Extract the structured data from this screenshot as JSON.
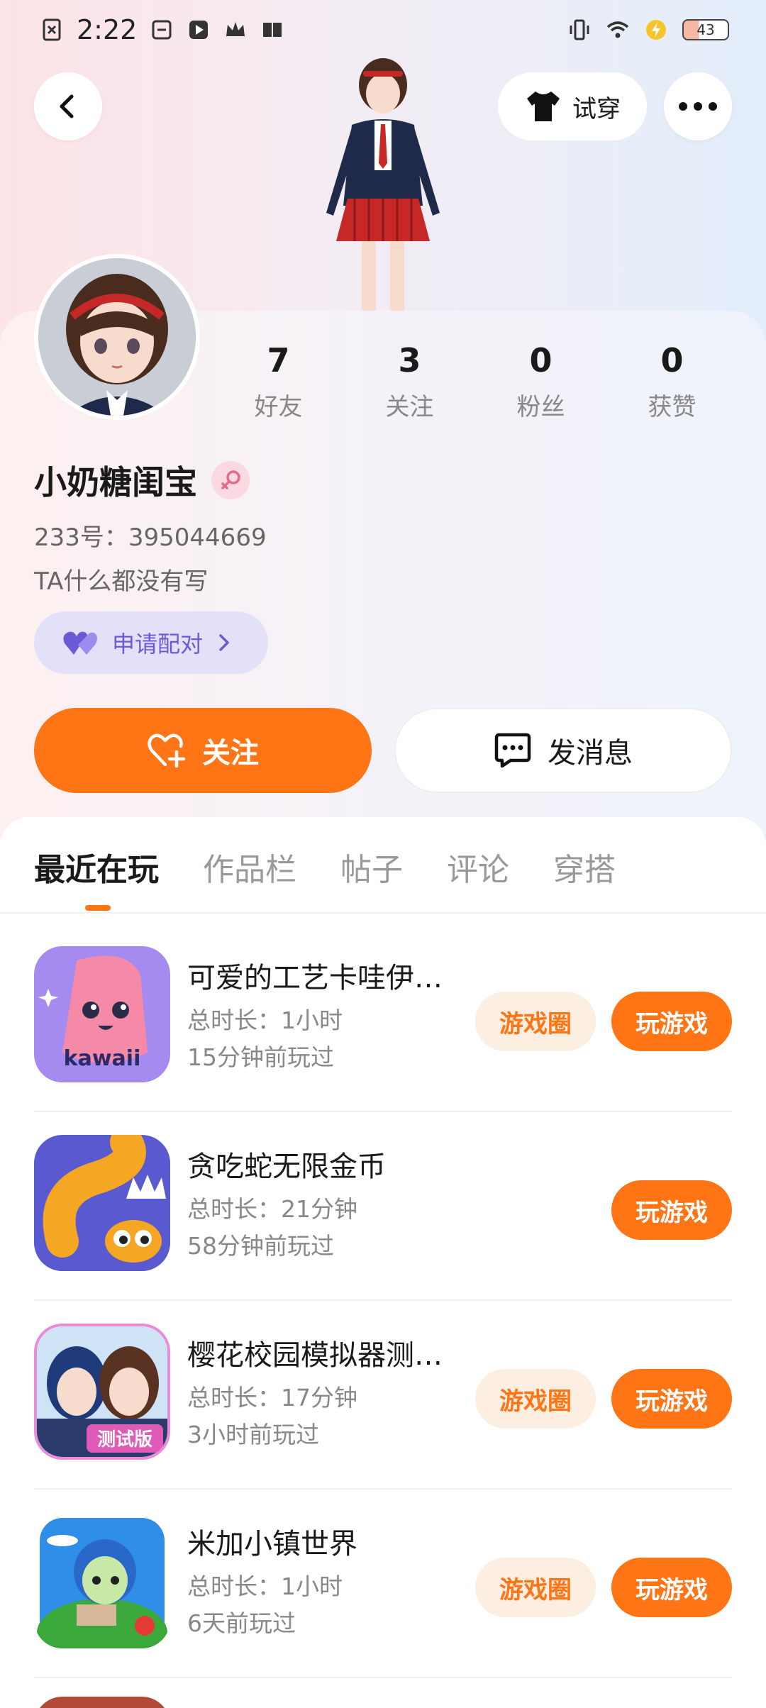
{
  "status_bar": {
    "time": "2:22",
    "battery": "43"
  },
  "header": {
    "tryon_label": "试穿"
  },
  "stats": [
    {
      "num": "7",
      "label": "好友"
    },
    {
      "num": "3",
      "label": "关注"
    },
    {
      "num": "0",
      "label": "粉丝"
    },
    {
      "num": "0",
      "label": "获赞"
    }
  ],
  "profile": {
    "nickname": "小奶糖闺宝",
    "uid": "233号：395044669",
    "bio": "TA什么都没有写",
    "pair_label": "申请配对"
  },
  "actions": {
    "follow": "关注",
    "message": "发消息"
  },
  "tabs": [
    "最近在玩",
    "作品栏",
    "帖子",
    "评论",
    "穿搭"
  ],
  "games": [
    {
      "title": "可爱的工艺卡哇伊…",
      "duration": "总时长：1小时",
      "last": "15分钟前玩过",
      "circle": "游戏圈",
      "play": "玩游戏",
      "icon_text": "kawaii"
    },
    {
      "title": "贪吃蛇无限金币",
      "duration": "总时长：21分钟",
      "last": "58分钟前玩过",
      "circle": "",
      "play": "玩游戏",
      "icon_text": ""
    },
    {
      "title": "樱花校园模拟器测…",
      "duration": "总时长：17分钟",
      "last": "3小时前玩过",
      "circle": "游戏圈",
      "play": "玩游戏",
      "icon_text": "测试版"
    },
    {
      "title": "米加小镇世界",
      "duration": "总时长：1小时",
      "last": "6天前玩过",
      "circle": "游戏圈",
      "play": "玩游戏",
      "icon_text": ""
    }
  ],
  "colors": {
    "accent": "#ff7415",
    "pair": "#6a5ad6"
  }
}
